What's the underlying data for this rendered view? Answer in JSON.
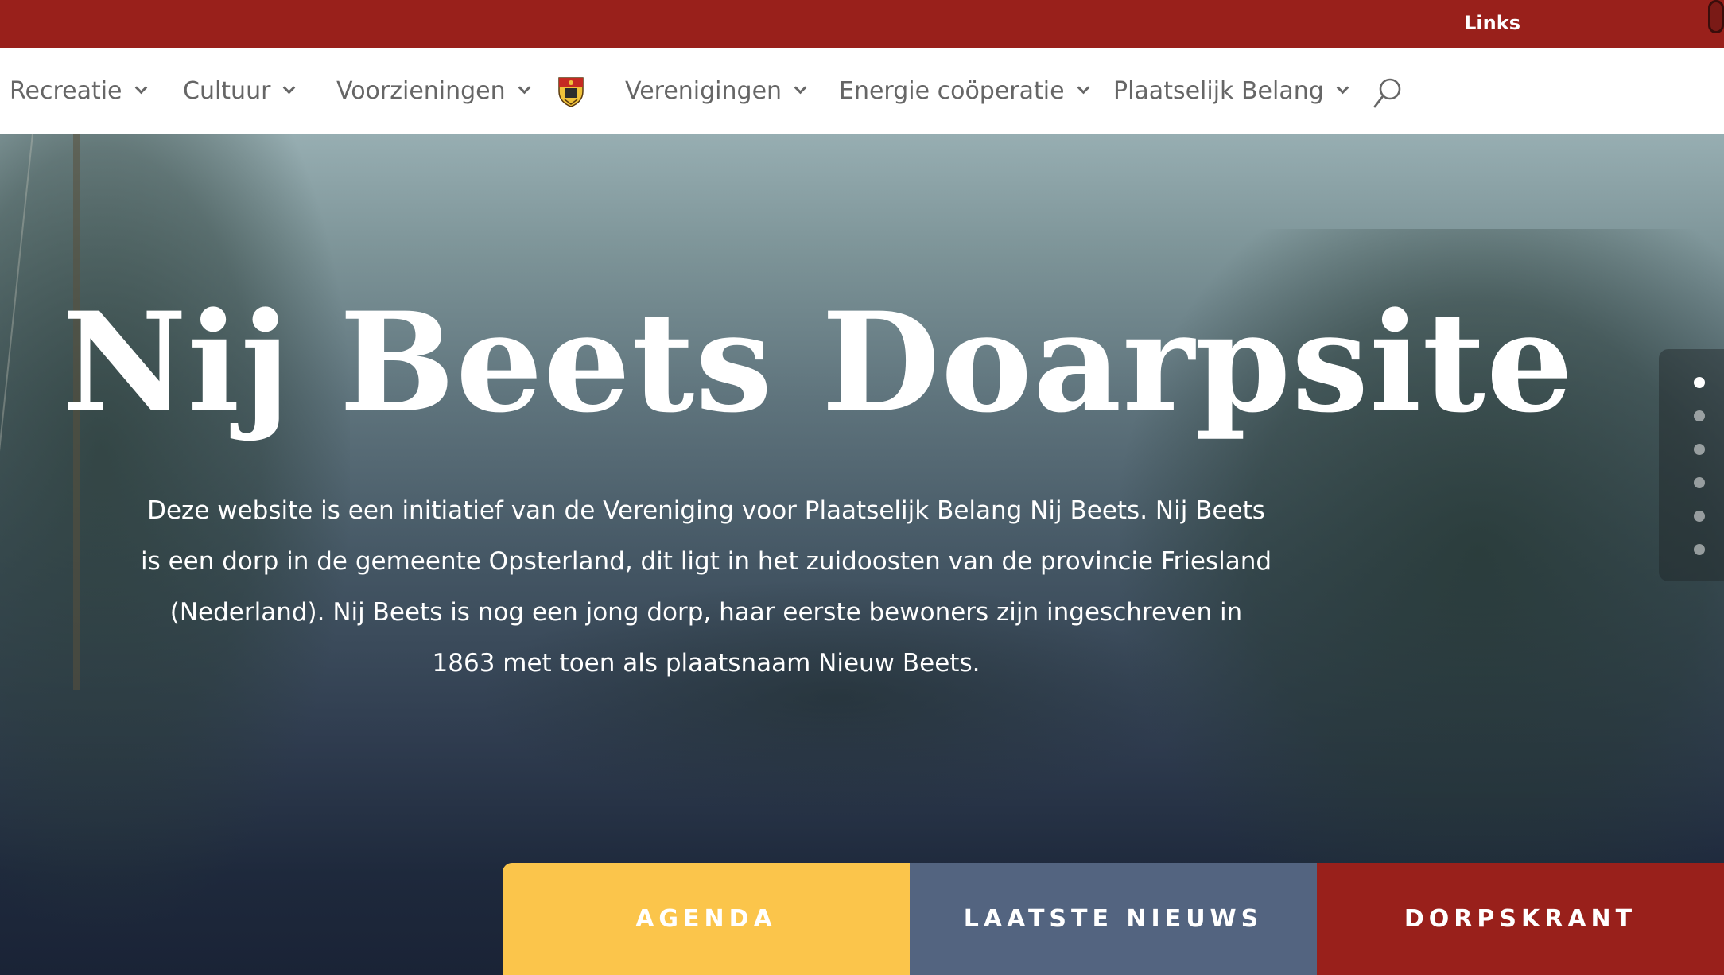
{
  "topbar": {
    "links_label": "Links"
  },
  "nav": {
    "items": [
      {
        "label": "Recreatie"
      },
      {
        "label": "Cultuur"
      },
      {
        "label": "Voorzieningen"
      },
      {
        "label": "Verenigingen"
      },
      {
        "label": "Energie coöperatie"
      },
      {
        "label": "Plaatselijk Belang"
      }
    ],
    "logo_icon": "coat-of-arms-icon",
    "search_icon": "search-icon"
  },
  "hero": {
    "title": "Nij Beets Doarpsite",
    "text": "Deze website is een initiatief van de Vereniging voor Plaatselijk Belang Nij Beets. Nij Beets is een dorp in de gemeente Opsterland, dit ligt in het zuidoosten van de provincie Friesland (Nederland).  Nij Beets is nog een jong dorp, haar eerste bewoners zijn ingeschreven in 1863 met toen als plaatsnaam Nieuw Beets.",
    "slide_count": 6,
    "active_slide": 1
  },
  "cta": {
    "agenda": "AGENDA",
    "nieuws": "LAATSTE NIEUWS",
    "krant": "DORPSKRANT"
  },
  "colors": {
    "brand_red": "#99201b",
    "agenda_yellow": "#fbc54b",
    "nieuws_slate": "#536480"
  }
}
